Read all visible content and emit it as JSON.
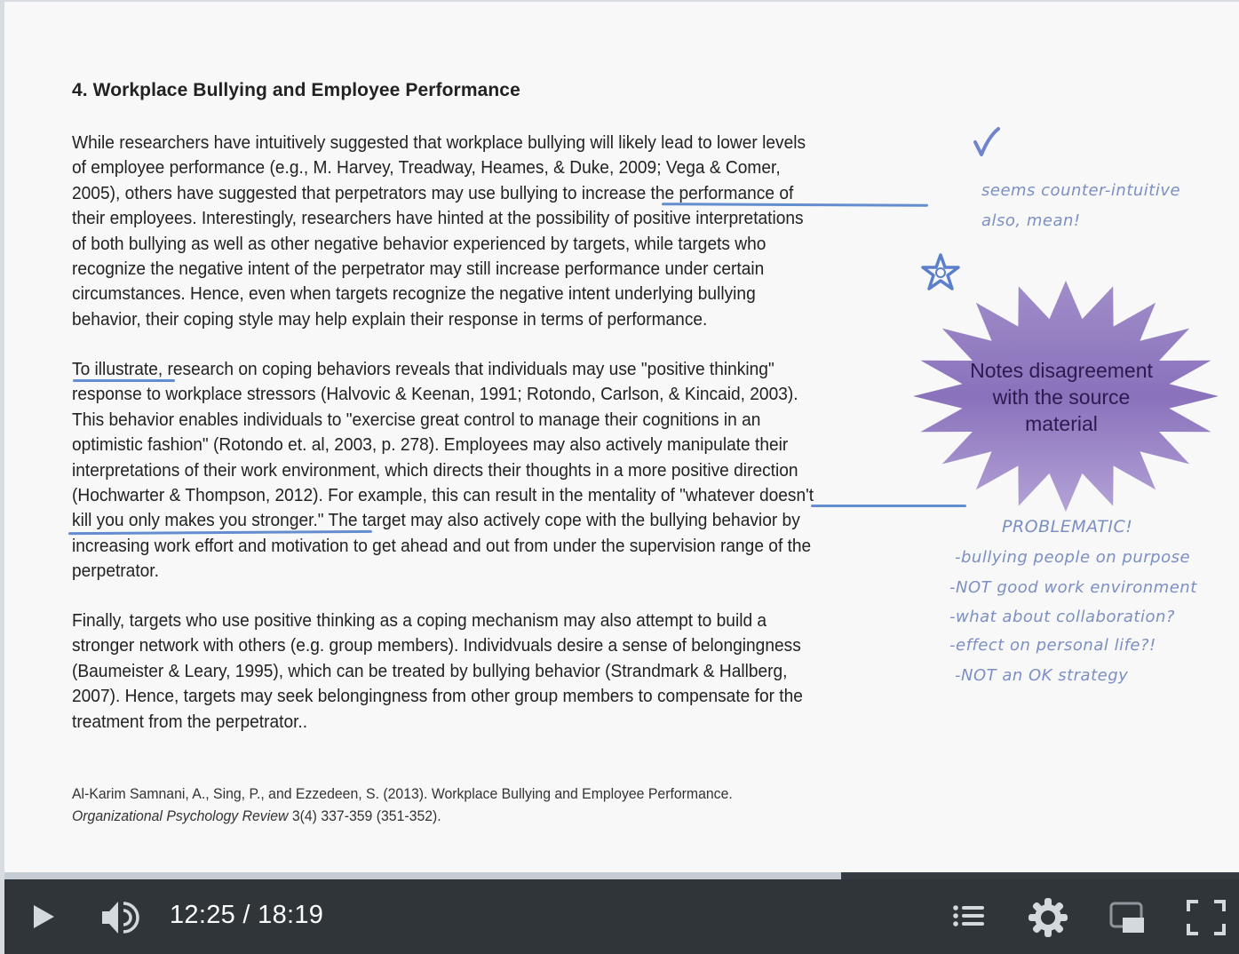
{
  "slide": {
    "heading": "4. Workplace Bullying and Employee Performance",
    "paragraph1": [
      "While researchers have intuitively suggested that workplace bullying will likely lead to lower levels",
      "of employee performance (e.g., M. Harvey, Treadway, Heames, & Duke, 2009; Vega & Comer,",
      "2005), others have suggested that perpetrators may use bullying to increase the performance of",
      "their employees. Interestingly, researchers have hinted at the possibility of positive interpretations",
      "of both bullying as well as other negative behavior experienced by targets, while targets who",
      "recognize the negative intent of the perpetrator may still increase performance under certain",
      "circumstances. Hence, even when targets recognize the negative intent underlying bullying",
      "behavior, their coping style may help explain their response in terms of performance."
    ],
    "paragraph2": [
      "To illustrate, research on coping behaviors reveals that individuals may use \"positive thinking\"",
      "response to workplace stressors (Halvovic & Keenan, 1991; Rotondo, Carlson, & Kincaid, 2003).",
      "This behavior enables individuals to \"exercise great control to manage their cognitions in an",
      "optimistic fashion\" (Rotondo et. al, 2003, p. 278). Employees may also actively manipulate their",
      "interpretations of their work environment, which directs their thoughts in a more positive direction",
      "(Hochwarter & Thompson, 2012). For example, this can result in the mentality of \"whatever doesn't",
      "kill you only makes you stronger.\" The target may also actively cope with the bullying behavior by",
      "increasing work effort and motivation to get ahead and out from under the supervision range of the",
      "perpetrator."
    ],
    "paragraph3": [
      "Finally, targets who use positive thinking as a coping mechanism may also attempt to build a",
      "stronger network with others (e.g. group members). Individvuals desire a sense of belongingness",
      "(Baumeister & Leary, 1995), which can be treated by bullying behavior (Strandmark & Hallberg,",
      "2007). Hence, targets may seek belongingness from other group members to compensate for the",
      "treatment from the perpetrator.."
    ],
    "citation": {
      "line1": "Al-Karim Samnani, A., Sing, P., and Ezzedeen, S. (2013). Workplace Bullying and Employee Performance.",
      "journal": "Organizational Psychology Review",
      "line2_rest": " 3(4) 337-359 (351-352)."
    }
  },
  "annotations": {
    "check_icon": "checkmark-icon",
    "star_icon": "star-icon",
    "note1": "seems counter-intuitive",
    "note2": "also, mean!",
    "burst_label": [
      "Notes disagreement",
      "with the source",
      "material"
    ],
    "problematic_title": "PROBLEMATIC!",
    "problematic_items": [
      "-bullying people on purpose",
      "-NOT good work environment",
      "-what about collaboration?",
      "-effect on personal life?!",
      "-NOT an OK strategy"
    ]
  },
  "player": {
    "current_time": "12:25",
    "duration": "18:19",
    "time_display": "12:25 / 18:19",
    "progress_fraction": 0.678,
    "colors": {
      "bar": "#30353a",
      "played": "#c5ccd3",
      "icon": "#d4d9de"
    }
  }
}
